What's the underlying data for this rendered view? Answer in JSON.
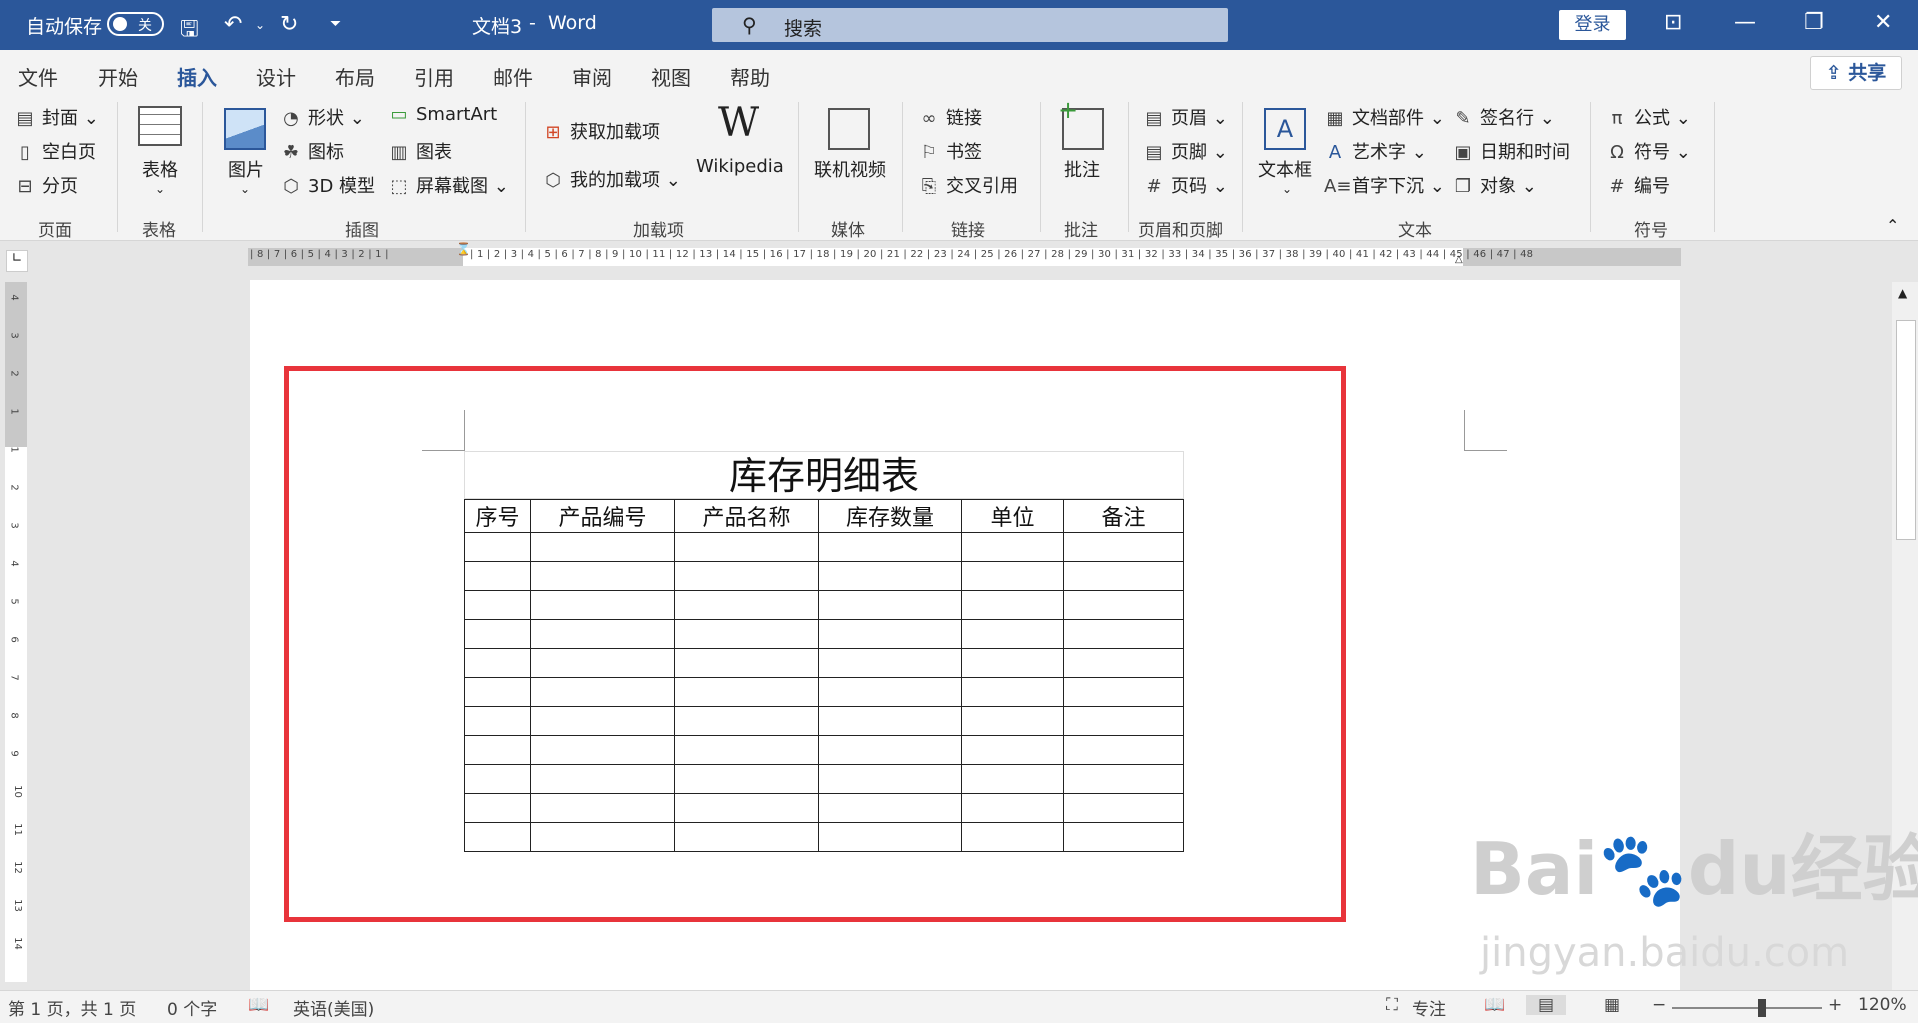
{
  "titlebar": {
    "autosave_label": "自动保存",
    "autosave_state": "关",
    "doc_title": "文档3",
    "separator": "-",
    "app_name": "Word",
    "search_placeholder": "搜索",
    "login_label": "登录"
  },
  "tabs": [
    "文件",
    "开始",
    "插入",
    "设计",
    "布局",
    "引用",
    "邮件",
    "审阅",
    "视图",
    "帮助"
  ],
  "active_tab": "插入",
  "share_label": "共享",
  "ribbon": {
    "page": {
      "items": [
        "封面",
        "空白页",
        "分页"
      ],
      "group": "页面"
    },
    "table": {
      "item": "表格",
      "group": "表格"
    },
    "illustrations": {
      "picture": "图片",
      "items": [
        "形状",
        "图标",
        "3D 模型"
      ],
      "items2": [
        "SmartArt",
        "图表",
        "屏幕截图"
      ],
      "group": "插图"
    },
    "addins": {
      "items": [
        "获取加载项",
        "我的加载项"
      ],
      "wikipedia": "Wikipedia",
      "group": "加载项"
    },
    "media": {
      "item": "联机视频",
      "group": "媒体"
    },
    "links": {
      "items": [
        "链接",
        "书签",
        "交叉引用"
      ],
      "group": "链接"
    },
    "comments": {
      "item": "批注",
      "group": "批注"
    },
    "header_footer": {
      "items": [
        "页眉",
        "页脚",
        "页码"
      ],
      "group": "页眉和页脚"
    },
    "text": {
      "textbox": "文本框",
      "items": [
        "文档部件",
        "艺术字",
        "首字下沉"
      ],
      "items2": [
        "签名行",
        "日期和时间",
        "对象"
      ],
      "group": "文本"
    },
    "symbols": {
      "items": [
        "公式",
        "符号",
        "编号"
      ],
      "group": "符号"
    }
  },
  "ruler": {
    "left_numbers": "| 8 | 7 | 6 | 5 | 4 | 3 | 2 | 1 |",
    "right_numbers": "| 1 | 2 | 3 | 4 | 5 | 6 | 7 | 8 | 9 | 10 | 11 | 12 | 13 | 14 | 15 | 16 | 17 | 18 | 19 | 20 | 21 | 22 | 23 | 24 | 25 | 26 | 27 | 28 | 29 | 30 | 31 | 32 | 33 | 34 | 35 | 36 | 37 | 38 | 39 | 40 | 41 | 42 | 43 | 44 | 45 | 46 | 47 | 48",
    "vertical_numbers": [
      "4",
      "3",
      "2",
      "1",
      "1",
      "2",
      "3",
      "4",
      "5",
      "6",
      "7",
      "8",
      "9",
      "10",
      "11",
      "12",
      "13",
      "14"
    ]
  },
  "document": {
    "table_title": "库存明细表",
    "headers": [
      "序号",
      "产品编号",
      "产品名称",
      "库存数量",
      "单位",
      "备注"
    ],
    "empty_rows": 11
  },
  "status": {
    "page": "第 1 页，共 1 页",
    "words": "0 个字",
    "language": "英语(美国)",
    "focus": "专注",
    "zoom_minus": "−",
    "zoom_plus": "+",
    "zoom": "120%",
    "zoom_level": 0.6
  },
  "watermark": {
    "brand": "Bai",
    "brand2": "du",
    "text": "经验",
    "url": "jingyan.baidu.com"
  }
}
